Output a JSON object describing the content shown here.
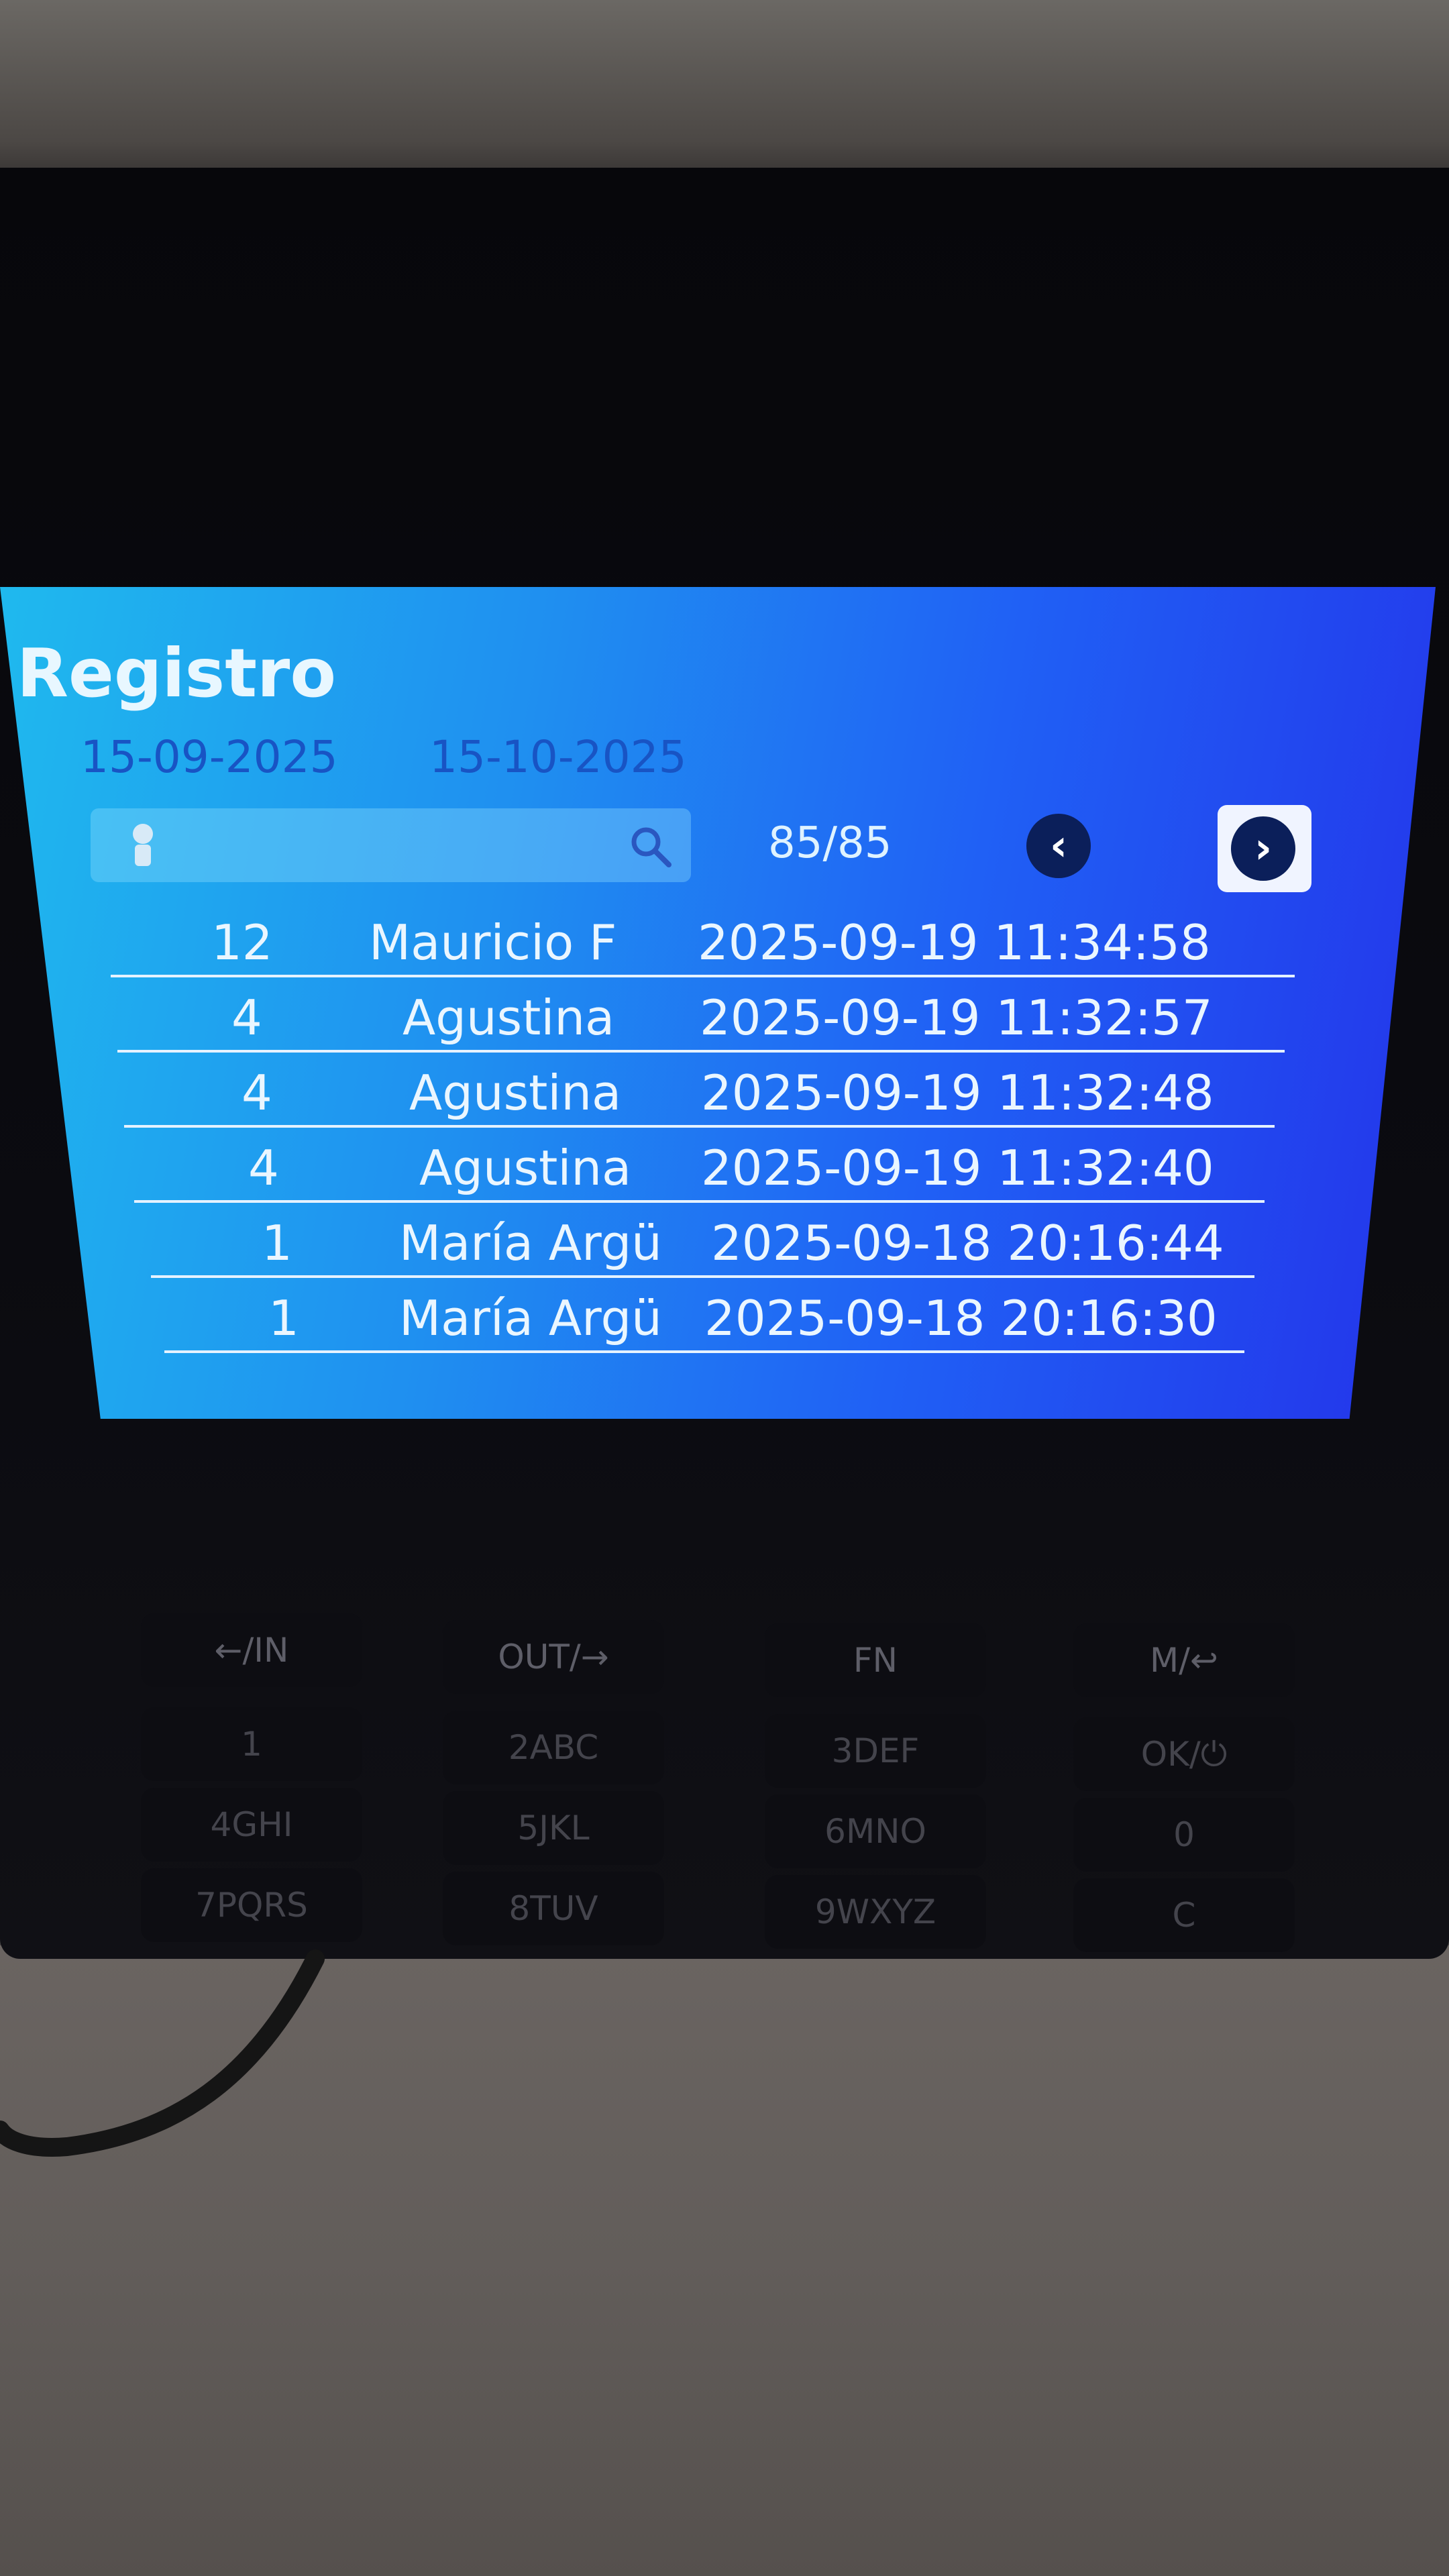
{
  "screen": {
    "title": "Registro",
    "date_from": "15-09-2025",
    "date_to": "15-10-2025",
    "counter": "85/85",
    "prev_symbol": "‹",
    "next_symbol": "›"
  },
  "records": [
    {
      "id": "12",
      "name": "Mauricio F",
      "datetime": "2025-09-19 11:34:58"
    },
    {
      "id": "4",
      "name": "Agustina",
      "datetime": "2025-09-19 11:32:57"
    },
    {
      "id": "4",
      "name": "Agustina",
      "datetime": "2025-09-19 11:32:48"
    },
    {
      "id": "4",
      "name": "Agustina",
      "datetime": "2025-09-19 11:32:40"
    },
    {
      "id": "1",
      "name": "María Argü",
      "datetime": "2025-09-18 20:16:44"
    },
    {
      "id": "1",
      "name": "María Argü",
      "datetime": "2025-09-18 20:16:30"
    }
  ],
  "keypad": {
    "in": "←/IN",
    "out": "OUT/→",
    "fn": "FN",
    "menu": "M/↩",
    "k1": "1",
    "k2": "2ABC",
    "k3": "3DEF",
    "ok": "OK/⏻",
    "k4": "4GHI",
    "k5": "5JKL",
    "k6": "6MNO",
    "k0": "0",
    "k7": "7PQRS",
    "k8": "8TUV",
    "k9": "9WXYZ",
    "c": "C"
  },
  "icons": {
    "user": "user-icon",
    "search": "search-icon",
    "prev": "chevron-left-icon",
    "next": "chevron-right-icon"
  }
}
